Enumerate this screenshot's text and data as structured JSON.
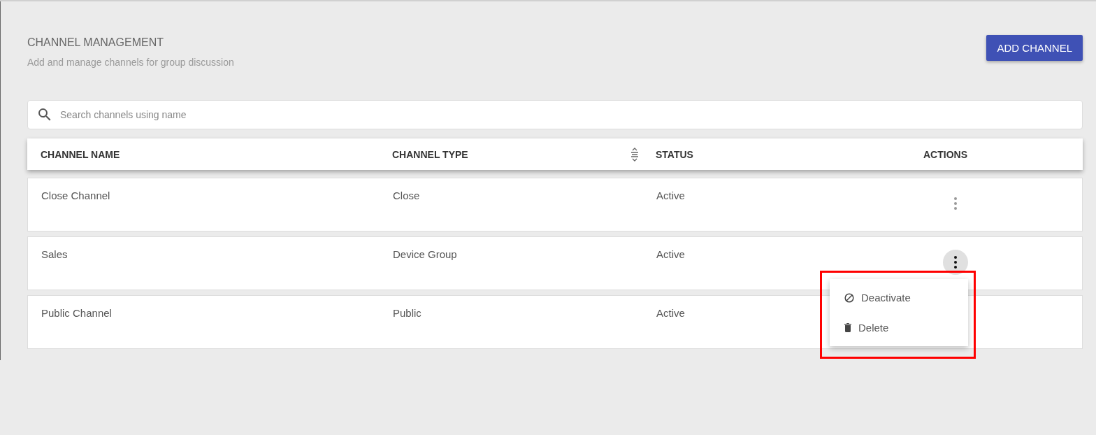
{
  "header": {
    "title": "CHANNEL MANAGEMENT",
    "subtitle": "Add and manage channels for group discussion",
    "add_button": "ADD CHANNEL"
  },
  "search": {
    "placeholder": "Search channels using name"
  },
  "table": {
    "columns": [
      {
        "label": "CHANNEL NAME",
        "sortable": false
      },
      {
        "label": "CHANNEL TYPE",
        "sortable": true
      },
      {
        "label": "STATUS",
        "sortable": false
      },
      {
        "label": "ACTIONS",
        "sortable": false
      }
    ],
    "rows": [
      {
        "name": "Close Channel",
        "type": "Close",
        "status": "Active",
        "menu_open": false
      },
      {
        "name": "Sales",
        "type": "Device Group",
        "status": "Active",
        "menu_open": true
      },
      {
        "name": "Public Channel",
        "type": "Public",
        "status": "Active",
        "menu_open": false
      }
    ]
  },
  "menu": {
    "highlighted": true,
    "items": [
      {
        "kind": "deactivate",
        "label": "Deactivate"
      },
      {
        "kind": "delete",
        "label": "Delete"
      }
    ]
  }
}
